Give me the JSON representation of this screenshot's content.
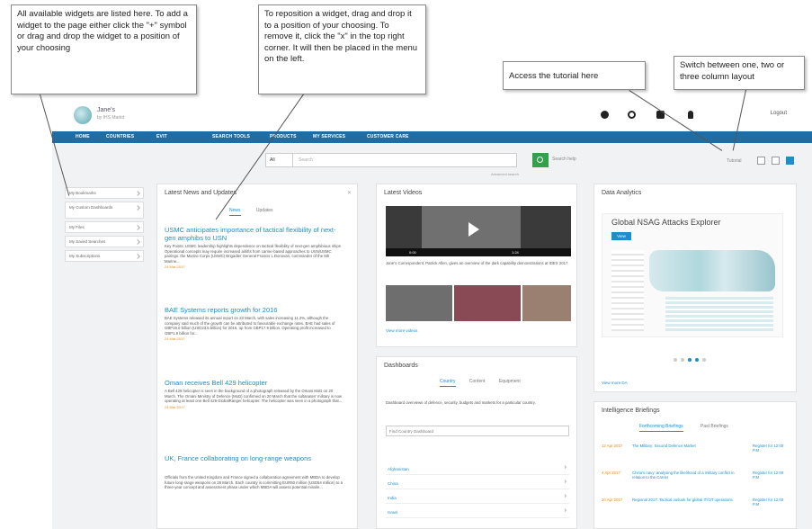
{
  "callouts": {
    "widgets": "All available widgets are listed here. To add a widget to the page either click the \"+\" symbol or drag and drop the widget to a position of your choosing",
    "reposition": "To reposition a widget, drag and drop it to a position of your choosing. To remove it, click the \"x\" in the top right corner. It will then be placed in the menu on the left.",
    "tutorial": "Access the tutorial here",
    "layout": "Switch between one, two or three column layout"
  },
  "app": {
    "logo_name": "Jane's",
    "logo_sub": "by IHS Markit",
    "login": "Logout",
    "nav": [
      "HOME",
      "COUNTRIES",
      "EVIT",
      "SEARCH TOOLS",
      "PRODUCTS",
      "MY SERVICES",
      "CUSTOMER CARE"
    ],
    "search": {
      "scope": "All",
      "placeholder": "Search",
      "help": "Search help",
      "advanced": "Advanced search"
    },
    "tutorial_label": "Tutorial",
    "sidebar": [
      "My Bookmarks",
      "My Custom Dashboards",
      "My Files",
      "My Saved Searches",
      "My Subscriptions"
    ],
    "news_panel": {
      "title": "Latest News and Updates",
      "tabs": [
        "News",
        "Updates"
      ],
      "items": [
        {
          "head": "USMC anticipates importance of tactical flexibility of next-gen amphibs to USN",
          "body": "Key Points: USMC leadership highlights dependence on tactical flexibility of next-gen amphibious ships Operational concepts may require increased airlifts from carrier-based approaches to USN/USMC pairings: the Marine Corps (USMC) Brigadier General Francis L Donovan, commander of the 5th Marine...",
          "date": "24 Mar 2017"
        },
        {
          "head": "BAE Systems reports growth for 2016",
          "body": "BAE Systems released its annual report on 23 March, with sales increasing 11.2%, although the company said much of the growth can be attributed to favourable exchange rates. BAE had sales of GBP19.0 billion (USD23.5 billion) for 2016, up from GBP17.9 billion. Operating profit increased to GBP1.9 billion for...",
          "date": "24 Mar 2017"
        },
        {
          "head": "Oman receives Bell 429 helicopter",
          "body": "A Bell 429 helicopter is seen in the background of a photograph released by the Omani MoD on 20 March. The Omani Ministry of Defence (MoD) confirmed on 20 March that the sultanates' military is now operating at least one Bell 429 GlobalRanger helicopter. The helicopter was seen in a photograph that...",
          "date": "24 Mar 2017"
        },
        {
          "head": "UK, France collaborating on long-range weapons",
          "body": "Officials from the United Kingdom and France signed a collaboration agreement with MBDA to develop future long-range weapons on 28 March. Each country is committing EUR50 million (USD54 million) to a three-year concept and assessment phase under which MBDA will assess potential missile...",
          "date": ""
        }
      ]
    },
    "video_panel": {
      "title": "Latest Videos",
      "time": "0:00",
      "duration": "1:24",
      "caption": "Jane's Correspondent, Patrick Allen, gives an overview of the dark capability demonstrations at IDEX 2017.",
      "view_all": "View more videos"
    },
    "dash_panel": {
      "title": "Dashboards",
      "tabs": [
        "Country",
        "Content",
        "Equipment"
      ],
      "desc": "Dashboard overviews of defence, security, budgets and markets for a particular country.",
      "select": "Find Country Dashboard",
      "rows": [
        "Afghanistan",
        "China",
        "India",
        "Israel"
      ]
    },
    "analytics_panel": {
      "title": "Data Analytics",
      "map_title": "Global NSAG Attacks Explorer",
      "view_btn": "View",
      "view_all": "View more DA"
    },
    "brief_panel": {
      "title": "Intelligence Briefings",
      "tabs": [
        "Forthcoming Briefings",
        "Past Briefings"
      ],
      "rows": [
        {
          "date": "12 Apr 2017",
          "text": "The Military: Second Defence Market",
          "reg": "Register for 12:00 P.M"
        },
        {
          "date": "4 Apr 2017",
          "text": "China's navy: analysing the likelihood of a military conflict in relation to the Carrier",
          "reg": "Register for 12:00 P.M"
        },
        {
          "date": "20 Apr 2017",
          "text": "Regional 2017: Tactical outlook for global IT/OT operations",
          "reg": "Register for 12:00 P.M"
        }
      ]
    }
  }
}
